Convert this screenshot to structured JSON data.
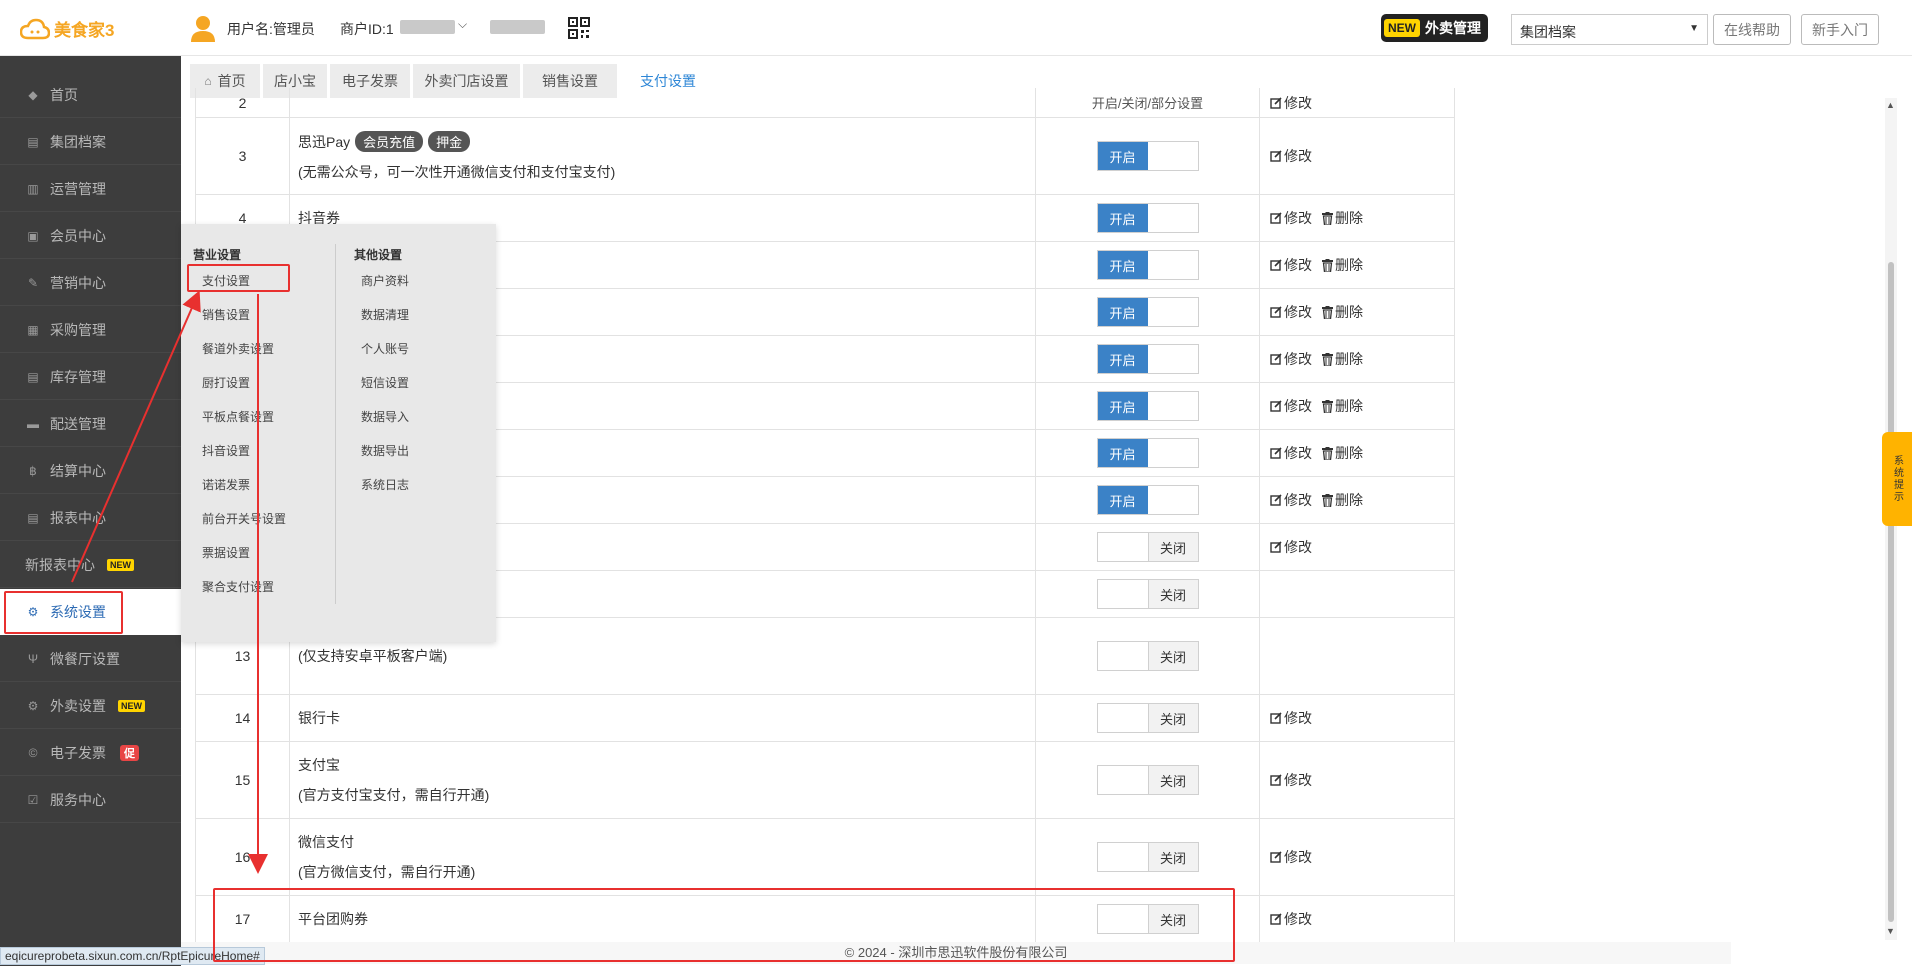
{
  "header": {
    "logo_text": "美食家3",
    "user_label": "用户名:",
    "user_value": "管理员",
    "merchant_label": "商户ID:",
    "merchant_prefix": "1",
    "new_badge": "NEW",
    "new_badge_text": "外卖管理",
    "select_value": "集团档案",
    "help_button": "在线帮助",
    "beginner_button": "新手入门"
  },
  "sidebar": {
    "items": [
      {
        "label": "首页",
        "icon": "dashboard-icon"
      },
      {
        "label": "集团档案",
        "icon": "file-icon"
      },
      {
        "label": "运营管理",
        "icon": "bar-chart-icon"
      },
      {
        "label": "会员中心",
        "icon": "id-card-icon"
      },
      {
        "label": "营销中心",
        "icon": "edit-icon"
      },
      {
        "label": "采购管理",
        "icon": "book-icon"
      },
      {
        "label": "库存管理",
        "icon": "file-text-icon"
      },
      {
        "label": "配送管理",
        "icon": "truck-icon"
      },
      {
        "label": "结算中心",
        "icon": "bitcoin-icon"
      },
      {
        "label": "报表中心",
        "icon": "report-icon"
      },
      {
        "label": "新报表中心",
        "icon": "",
        "tag": "NEW"
      },
      {
        "label": "系统设置",
        "icon": "cogs-icon"
      },
      {
        "label": "微餐厅设置",
        "icon": "cutlery-icon"
      },
      {
        "label": "外卖设置",
        "icon": "gear-icon",
        "tag": "NEW"
      },
      {
        "label": "电子发票",
        "icon": "copyright-icon",
        "tag": "促"
      },
      {
        "label": "服务中心",
        "icon": "check-square-icon"
      }
    ]
  },
  "tabs": [
    {
      "label": "首页"
    },
    {
      "label": "店小宝"
    },
    {
      "label": "电子发票"
    },
    {
      "label": "外卖门店设置"
    },
    {
      "label": "销售设置"
    },
    {
      "label": "支付设置"
    }
  ],
  "popup": {
    "col1_title": "营业设置",
    "col1_items": [
      "支付设置",
      "销售设置",
      "餐道外卖设置",
      "厨打设置",
      "平板点餐设置",
      "抖音设置",
      "诺诺发票",
      "前台开关号设置",
      "票据设置",
      "聚合支付设置"
    ],
    "col2_title": "其他设置",
    "col2_items": [
      "商户资料",
      "数据清理",
      "个人账号",
      "短信设置",
      "数据导入",
      "数据导出",
      "系统日志"
    ]
  },
  "table": {
    "on_label": "开启",
    "off_label": "关闭",
    "edit_label": "修改",
    "delete_label": "删除",
    "partial_row_no": "2",
    "partial_row_status": "开启/关闭/部分设置",
    "rows": [
      {
        "no": "3",
        "name": "思迅Pay",
        "pills": [
          "会员充值",
          "押金"
        ],
        "desc": "(无需公众号，可一次性开通微信支付和支付宝支付)",
        "on": true,
        "edit": true,
        "del": false
      },
      {
        "no": "4",
        "name": "抖音券",
        "desc": "",
        "on": true,
        "edit": true,
        "del": true
      },
      {
        "no": "",
        "name": "",
        "desc": "",
        "on": true,
        "edit": true,
        "del": true
      },
      {
        "no": "",
        "name": "",
        "desc": "",
        "on": true,
        "edit": true,
        "del": true
      },
      {
        "no": "",
        "name": "",
        "desc": "",
        "on": true,
        "edit": true,
        "del": true
      },
      {
        "no": "",
        "name": "",
        "desc": "",
        "on": true,
        "edit": true,
        "del": true
      },
      {
        "no": "",
        "name": "",
        "desc": "",
        "on": true,
        "edit": true,
        "del": true
      },
      {
        "no": "",
        "name": "",
        "desc": "",
        "on": true,
        "edit": true,
        "del": true
      },
      {
        "no": "",
        "name": "",
        "desc": "",
        "on": false,
        "edit": true,
        "del": false
      },
      {
        "no": "",
        "name": "",
        "desc": "",
        "on": false,
        "edit": false,
        "del": false
      },
      {
        "no": "13",
        "name": "",
        "desc": "(仅支持安卓平板客户端)",
        "on": false,
        "edit": false,
        "del": false
      },
      {
        "no": "14",
        "name": "银行卡",
        "desc": "",
        "on": false,
        "edit": true,
        "del": false
      },
      {
        "no": "15",
        "name": "支付宝",
        "desc": "(官方支付宝支付，需自行开通)",
        "on": false,
        "edit": true,
        "del": false
      },
      {
        "no": "16",
        "name": "微信支付",
        "desc": "(官方微信支付，需自行开通)",
        "on": false,
        "edit": true,
        "del": false
      },
      {
        "no": "17",
        "name": "平台团购券",
        "desc": "",
        "on": false,
        "edit": true,
        "del": false
      }
    ]
  },
  "right": {
    "system_tip": "系统提示"
  },
  "footer": {
    "copyright": "© 2024 - 深圳市思迅软件股份有限公司",
    "status_url": "eqicureprobeta.sixun.com.cn/RptEpicureHome#"
  },
  "colors": {
    "accent_blue": "#3b82c7",
    "annotation_red": "#e8302f",
    "sidebar_bg": "#3d3d3d",
    "logo_orange": "#f5a623"
  }
}
